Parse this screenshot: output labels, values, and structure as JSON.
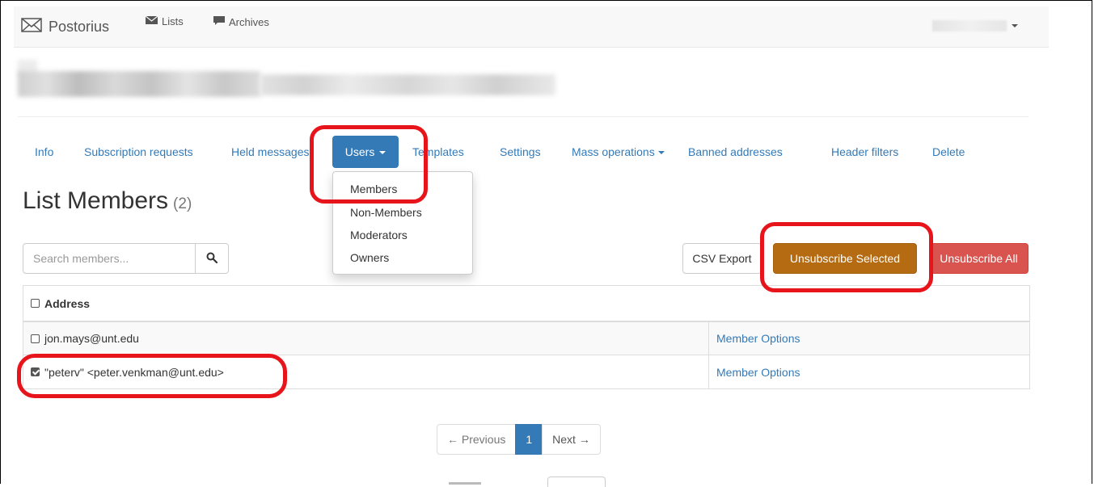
{
  "navbar": {
    "brand": "Postorius",
    "links": [
      {
        "label": "Lists",
        "icon": "envelope-stack-icon"
      },
      {
        "label": "Archives",
        "icon": "comment-icon"
      }
    ],
    "user_menu_icon": "caret-down-icon"
  },
  "tabs": [
    {
      "label": "Info"
    },
    {
      "label": "Subscription requests"
    },
    {
      "label": "Held messages"
    },
    {
      "label": "Users",
      "active": true,
      "dropdown": true
    },
    {
      "label": "Templates"
    },
    {
      "label": "Settings"
    },
    {
      "label": "Mass operations",
      "dropdown": true
    },
    {
      "label": "Banned addresses"
    },
    {
      "label": "Header filters"
    },
    {
      "label": "Delete"
    }
  ],
  "users_dropdown": [
    "Members",
    "Non-Members",
    "Moderators",
    "Owners"
  ],
  "page": {
    "title": "List Members",
    "count": "(2)"
  },
  "search": {
    "placeholder": "Search members..."
  },
  "actions": {
    "csv_export": "CSV Export",
    "unsubscribe_selected": "Unsubscribe Selected",
    "unsubscribe_all": "Unsubscribe All"
  },
  "table": {
    "header": "Address",
    "rows": [
      {
        "address": "jon.mays@unt.edu",
        "checked": false,
        "option": "Member Options"
      },
      {
        "address": "\"peterv\" <peter.venkman@unt.edu>",
        "checked": true,
        "option": "Member Options"
      }
    ]
  },
  "pagination": {
    "previous": "← Previous",
    "current": "1",
    "next": "Next →"
  },
  "colors": {
    "primary": "#337ab7",
    "warning": "#b56b12",
    "danger": "#d9534f",
    "annotation": "#e8141c"
  }
}
